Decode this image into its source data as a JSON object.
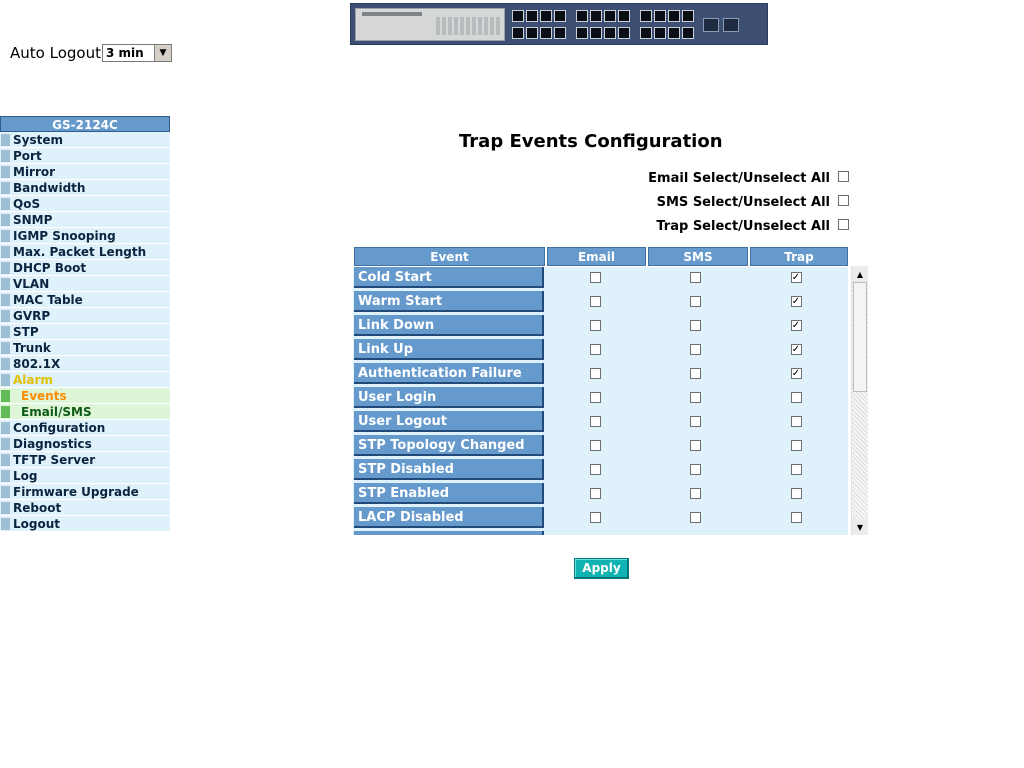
{
  "auto_logout": {
    "label": "Auto Logout",
    "value": "3 min"
  },
  "sidebar": {
    "title": "GS-2124C",
    "items": [
      {
        "label": "System"
      },
      {
        "label": "Port"
      },
      {
        "label": "Mirror"
      },
      {
        "label": "Bandwidth"
      },
      {
        "label": "QoS"
      },
      {
        "label": "SNMP"
      },
      {
        "label": "IGMP Snooping"
      },
      {
        "label": "Max. Packet Length"
      },
      {
        "label": "DHCP Boot"
      },
      {
        "label": "VLAN"
      },
      {
        "label": "MAC Table"
      },
      {
        "label": "GVRP"
      },
      {
        "label": "STP"
      },
      {
        "label": "Trunk"
      },
      {
        "label": "802.1X"
      },
      {
        "label": "Alarm"
      },
      {
        "label": "Events"
      },
      {
        "label": "Email/SMS"
      },
      {
        "label": "Configuration"
      },
      {
        "label": "Diagnostics"
      },
      {
        "label": "TFTP Server"
      },
      {
        "label": "Log"
      },
      {
        "label": "Firmware Upgrade"
      },
      {
        "label": "Reboot"
      },
      {
        "label": "Logout"
      }
    ]
  },
  "page": {
    "title": "Trap Events Configuration",
    "email_select_all": "Email Select/Unselect All",
    "sms_select_all": "SMS Select/Unselect All",
    "trap_select_all": "Trap Select/Unselect All"
  },
  "table": {
    "headers": [
      "Event",
      "Email",
      "SMS",
      "Trap"
    ],
    "rows": [
      {
        "event": "Cold Start",
        "email": false,
        "sms": false,
        "trap": true
      },
      {
        "event": "Warm Start",
        "email": false,
        "sms": false,
        "trap": true
      },
      {
        "event": "Link Down",
        "email": false,
        "sms": false,
        "trap": true
      },
      {
        "event": "Link Up",
        "email": false,
        "sms": false,
        "trap": true
      },
      {
        "event": "Authentication Failure",
        "email": false,
        "sms": false,
        "trap": true
      },
      {
        "event": "User Login",
        "email": false,
        "sms": false,
        "trap": false
      },
      {
        "event": "User Logout",
        "email": false,
        "sms": false,
        "trap": false
      },
      {
        "event": "STP Topology Changed",
        "email": false,
        "sms": false,
        "trap": false
      },
      {
        "event": "STP Disabled",
        "email": false,
        "sms": false,
        "trap": false
      },
      {
        "event": "STP Enabled",
        "email": false,
        "sms": false,
        "trap": false
      },
      {
        "event": "LACP Disabled",
        "email": false,
        "sms": false,
        "trap": false
      }
    ]
  },
  "apply_label": "Apply",
  "colors": {
    "header_blue": "#6699cc",
    "row_bg": "#dff1fb",
    "apply": "#11b2b2",
    "alarm": "#e0c000",
    "active_sub": "#ff8c00"
  }
}
